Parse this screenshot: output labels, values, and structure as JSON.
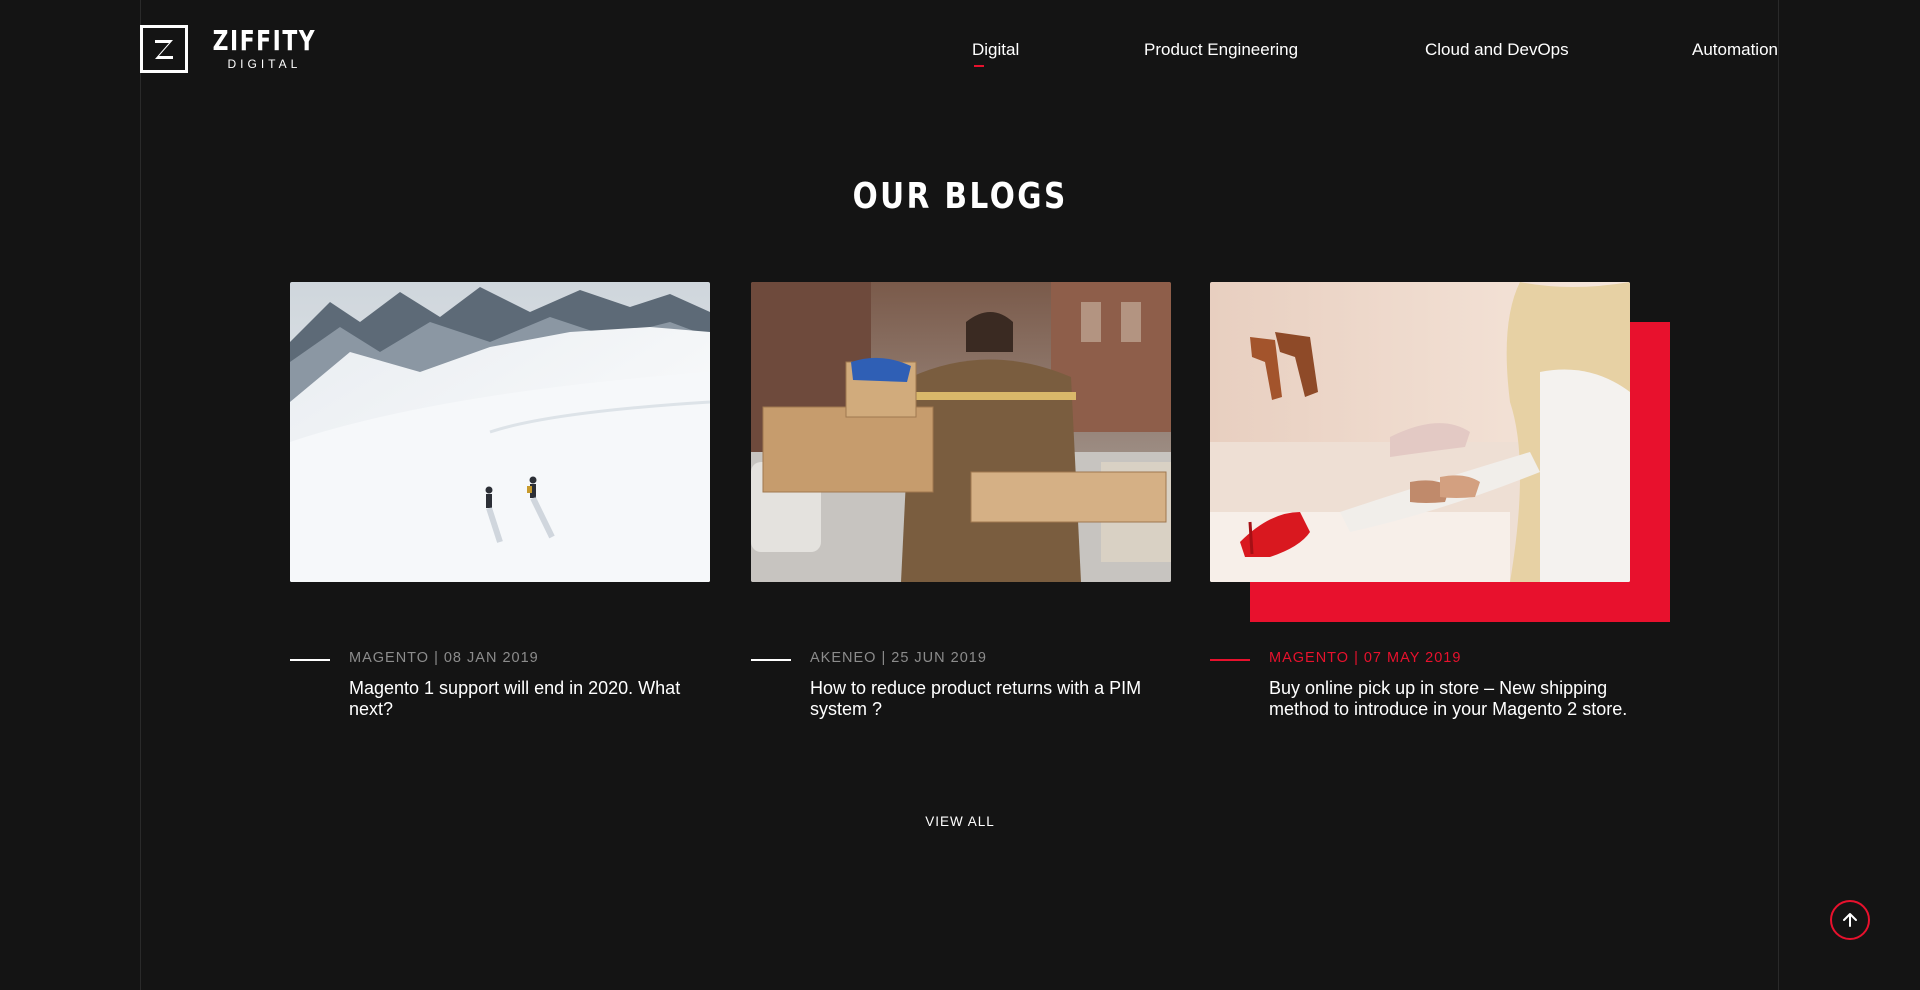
{
  "brand": {
    "name": "ZIFFITY",
    "sub": "DIGITAL",
    "accent": "#e8112d",
    "background": "#141414"
  },
  "nav": [
    {
      "label": "Digital",
      "active": true
    },
    {
      "label": "Product Engineering"
    },
    {
      "label": "Cloud and DevOps"
    },
    {
      "label": "Automation"
    }
  ],
  "section": {
    "title": "OUR BLOGS"
  },
  "blogs": [
    {
      "image": "snowy-mountain-hikers-photo",
      "meta": "MAGENTO | 08 JAN 2019",
      "title": "Magento 1 support will end in 2020. What next?"
    },
    {
      "image": "delivery-man-with-boxes-photo",
      "meta": "AKENEO | 25 JUN 2019",
      "title": "How to reduce product returns with a PIM system ?"
    },
    {
      "image": "woman-shopping-shoes-photo",
      "meta": "MAGENTO | 07 MAY 2019",
      "title": "Buy online pick up in store – New shipping method to introduce in your Magento 2 store.",
      "highlighted": true
    }
  ],
  "view_all": "VIEW ALL",
  "icons": {
    "logo": "z-logo-icon",
    "scroll_top": "arrow-up-icon"
  }
}
